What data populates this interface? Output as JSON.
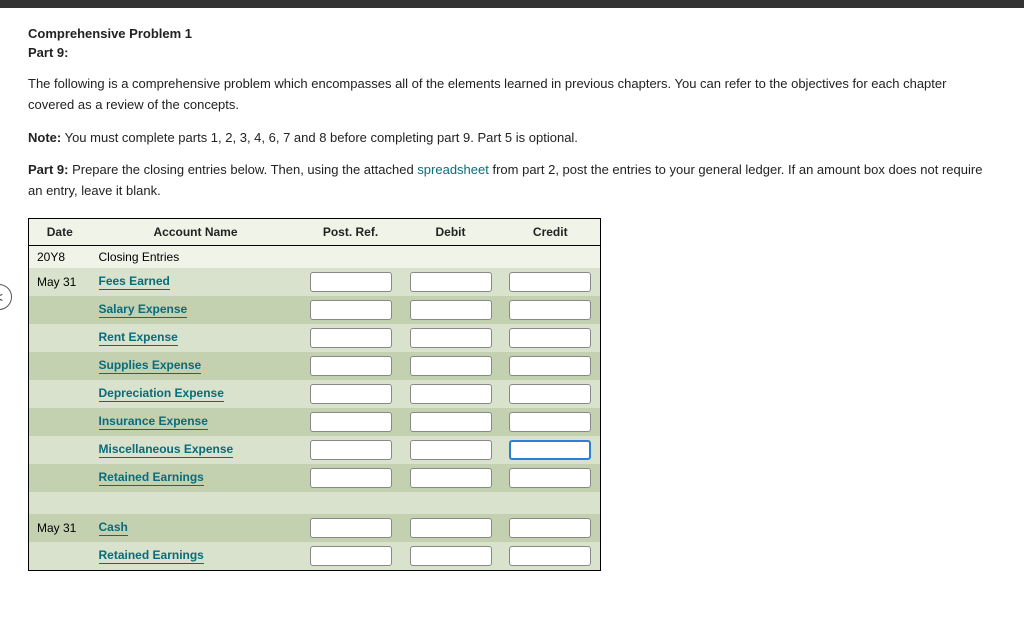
{
  "heading": {
    "title": "Comprehensive Problem 1",
    "part": "Part 9:"
  },
  "paragraphs": {
    "intro": "The following is a comprehensive problem which encompasses all of the elements learned in previous chapters. You can refer to the objectives for each chapter covered as a review of the concepts.",
    "note_label": "Note:",
    "note_text": " You must complete parts 1, 2, 3, 4, 6, 7 and 8 before completing part 9. Part 5 is optional.",
    "part9_label": "Part 9:",
    "part9_before": " Prepare the closing entries below. Then, using the attached ",
    "part9_link": "spreadsheet",
    "part9_after": " from part 2, post the entries to your general ledger. If an amount box does not require an entry, leave it blank."
  },
  "table": {
    "headers": {
      "date": "Date",
      "account": "Account Name",
      "postref": "Post. Ref.",
      "debit": "Debit",
      "credit": "Credit"
    },
    "year": "20Y8",
    "closing_label": "Closing Entries",
    "rows": [
      {
        "date": "May 31",
        "account": "Fees Earned",
        "inputs": true
      },
      {
        "date": "",
        "account": "Salary Expense",
        "inputs": true
      },
      {
        "date": "",
        "account": "Rent Expense",
        "inputs": true
      },
      {
        "date": "",
        "account": "Supplies Expense",
        "inputs": true
      },
      {
        "date": "",
        "account": "Depreciation Expense",
        "inputs": true
      },
      {
        "date": "",
        "account": "Insurance Expense",
        "inputs": true
      },
      {
        "date": "",
        "account": "Miscellaneous Expense",
        "inputs": true,
        "focused_credit": true
      },
      {
        "date": "",
        "account": "Retained Earnings",
        "inputs": true
      },
      {
        "date": "",
        "account": "",
        "inputs": false,
        "blank": true
      },
      {
        "date": "May 31",
        "account": "Cash",
        "inputs": true
      },
      {
        "date": "",
        "account": "Retained Earnings",
        "inputs": true
      }
    ]
  },
  "edge_button": "<"
}
